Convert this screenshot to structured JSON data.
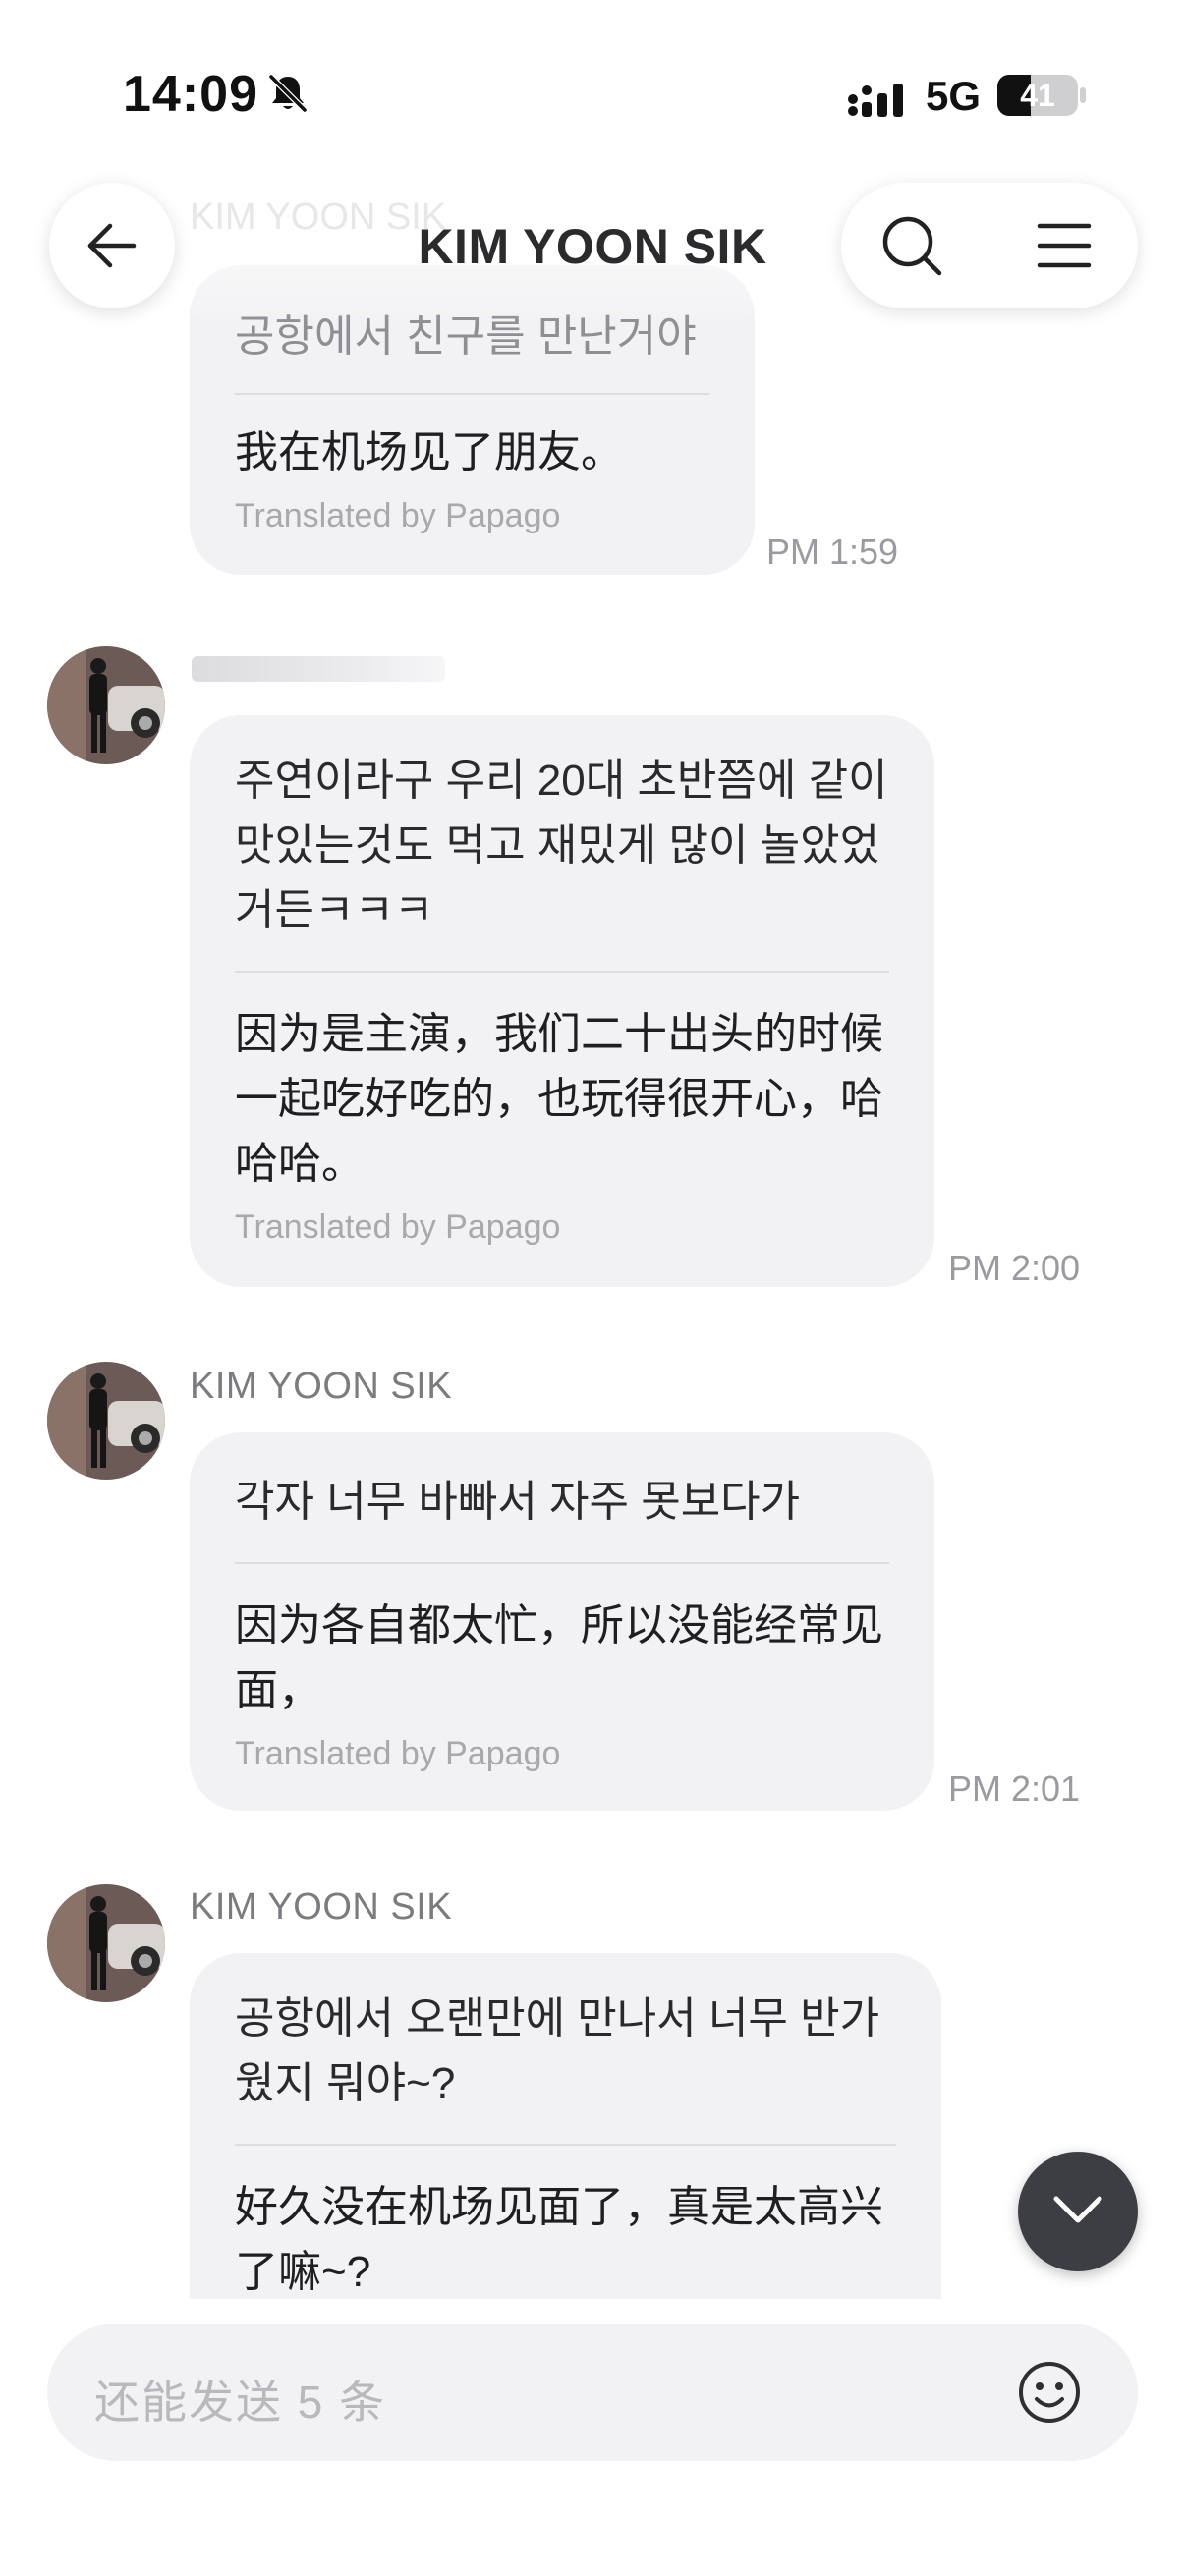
{
  "status_bar": {
    "time": "14:09",
    "network": "5G",
    "battery": "41"
  },
  "header": {
    "title": "KIM YOON SIK",
    "ghost_sender": "KIM YOON SIK"
  },
  "messages": [
    {
      "original": "공항에서 친구를 만난거야",
      "translation": "我在机场见了朋友。",
      "credit": "Translated by Papago",
      "time": "PM 1:59"
    },
    {
      "original": "주연이라구 우리 20대 초반쯤에 같이 맛있는것도 먹고 재밌게 많이 놀았었거든ㅋㅋㅋ",
      "translation": "因为是主演，我们二十出头的时候一起吃好吃的，也玩得很开心，哈哈哈。",
      "credit": "Translated by Papago",
      "time": "PM 2:00"
    },
    {
      "sender": "KIM YOON SIK",
      "original": "각자 너무 바빠서 자주 못보다가",
      "translation": "因为各自都太忙，所以没能经常见面，",
      "credit": "Translated by Papago",
      "time": "PM 2:01"
    },
    {
      "sender": "KIM YOON SIK",
      "original": "공항에서 오랜만에 만나서 너무 반가웠지 뭐야~?",
      "translation": "好久没在机场见面了，真是太高兴了嘛~?"
    }
  ],
  "composer": {
    "placeholder": "还能发送 5 条"
  },
  "icons": {
    "back": "arrow-left-icon",
    "search": "search-icon",
    "menu": "hamburger-menu-icon",
    "emoji": "smiley-icon",
    "scroll_down": "chevron-down-icon",
    "mute": "bell-slash-icon",
    "signal": "signal-bars-icon"
  }
}
